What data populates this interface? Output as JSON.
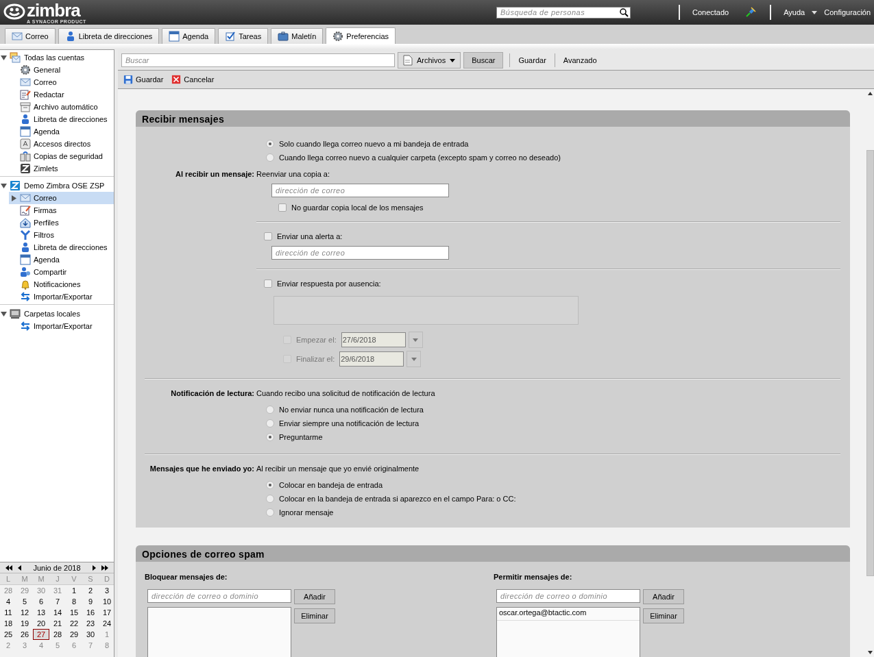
{
  "header": {
    "logo": "zimbra",
    "tagline": "A SYNACOR PRODUCT",
    "people_search": {
      "placeholder": "Búsqueda de personas"
    },
    "status": "Conectado",
    "help": "Ayuda",
    "settings": "Configuración"
  },
  "tabs": [
    {
      "label": "Correo",
      "kind": "mail",
      "selected": false
    },
    {
      "label": "Libreta de direcciones",
      "kind": "contact",
      "selected": false
    },
    {
      "label": "Agenda",
      "kind": "calendar",
      "selected": false
    },
    {
      "label": "Tareas",
      "kind": "tasks",
      "selected": false
    },
    {
      "label": "Maletín",
      "kind": "briefcase",
      "selected": false
    },
    {
      "label": "Preferencias",
      "kind": "gear",
      "selected": true
    }
  ],
  "sidebar": {
    "sections": [
      {
        "label": "Todas las cuentas",
        "kind": "accounts",
        "expanded": true,
        "items": [
          {
            "label": "General",
            "kind": "gear",
            "selected": false
          },
          {
            "label": "Correo",
            "kind": "mail",
            "selected": false
          },
          {
            "label": "Redactar",
            "kind": "compose",
            "selected": false
          },
          {
            "label": "Archivo automático",
            "kind": "archive",
            "selected": false
          },
          {
            "label": "Libreta de direcciones",
            "kind": "contact",
            "selected": false
          },
          {
            "label": "Agenda",
            "kind": "calendar",
            "selected": false
          },
          {
            "label": "Accesos directos",
            "kind": "key",
            "selected": false
          },
          {
            "label": "Copias de seguridad",
            "kind": "backup",
            "selected": false
          },
          {
            "label": "Zimlets",
            "kind": "zimlet",
            "selected": false
          }
        ]
      },
      {
        "label": "Demo Zimbra OSE ZSP",
        "kind": "account",
        "expanded": true,
        "items": [
          {
            "label": "Correo",
            "kind": "mail",
            "selected": true,
            "expanded": false
          },
          {
            "label": "Firmas",
            "kind": "signature",
            "selected": false
          },
          {
            "label": "Perfiles",
            "kind": "profile",
            "selected": false
          },
          {
            "label": "Filtros",
            "kind": "filter",
            "selected": false
          },
          {
            "label": "Libreta de direcciones",
            "kind": "contact",
            "selected": false
          },
          {
            "label": "Agenda",
            "kind": "calendar",
            "selected": false
          },
          {
            "label": "Compartir",
            "kind": "share",
            "selected": false
          },
          {
            "label": "Notificaciones",
            "kind": "bell",
            "selected": false
          },
          {
            "label": "Importar/Exportar",
            "kind": "transfer",
            "selected": false
          }
        ]
      },
      {
        "label": "Carpetas locales",
        "kind": "local",
        "expanded": true,
        "items": [
          {
            "label": "Importar/Exportar",
            "kind": "transfer",
            "selected": false
          }
        ]
      }
    ]
  },
  "calendar": {
    "title": "Junio de 2018",
    "weekdays": [
      "L",
      "M",
      "M",
      "J",
      "V",
      "S",
      "D"
    ],
    "weeks": [
      [
        {
          "day": "28",
          "outside": true,
          "selected": false
        },
        {
          "day": "29",
          "outside": true,
          "selected": false
        },
        {
          "day": "30",
          "outside": true,
          "selected": false
        },
        {
          "day": "31",
          "outside": true,
          "selected": false
        },
        {
          "day": "1",
          "outside": false,
          "selected": false
        },
        {
          "day": "2",
          "outside": false,
          "selected": false
        },
        {
          "day": "3",
          "outside": false,
          "selected": false
        }
      ],
      [
        {
          "day": "4",
          "outside": false,
          "selected": false
        },
        {
          "day": "5",
          "outside": false,
          "selected": false
        },
        {
          "day": "6",
          "outside": false,
          "selected": false
        },
        {
          "day": "7",
          "outside": false,
          "selected": false
        },
        {
          "day": "8",
          "outside": false,
          "selected": false
        },
        {
          "day": "9",
          "outside": false,
          "selected": false
        },
        {
          "day": "10",
          "outside": false,
          "selected": false
        }
      ],
      [
        {
          "day": "11",
          "outside": false,
          "selected": false
        },
        {
          "day": "12",
          "outside": false,
          "selected": false
        },
        {
          "day": "13",
          "outside": false,
          "selected": false
        },
        {
          "day": "14",
          "outside": false,
          "selected": false
        },
        {
          "day": "15",
          "outside": false,
          "selected": false
        },
        {
          "day": "16",
          "outside": false,
          "selected": false
        },
        {
          "day": "17",
          "outside": false,
          "selected": false
        }
      ],
      [
        {
          "day": "18",
          "outside": false,
          "selected": false
        },
        {
          "day": "19",
          "outside": false,
          "selected": false
        },
        {
          "day": "20",
          "outside": false,
          "selected": false
        },
        {
          "day": "21",
          "outside": false,
          "selected": false
        },
        {
          "day": "22",
          "outside": false,
          "selected": false
        },
        {
          "day": "23",
          "outside": false,
          "selected": false
        },
        {
          "day": "24",
          "outside": false,
          "selected": false
        }
      ],
      [
        {
          "day": "25",
          "outside": false,
          "selected": false
        },
        {
          "day": "26",
          "outside": false,
          "selected": false
        },
        {
          "day": "27",
          "outside": false,
          "selected": true
        },
        {
          "day": "28",
          "outside": false,
          "selected": false
        },
        {
          "day": "29",
          "outside": false,
          "selected": false
        },
        {
          "day": "30",
          "outside": false,
          "selected": false
        },
        {
          "day": "1",
          "outside": true,
          "selected": false
        }
      ],
      [
        {
          "day": "2",
          "outside": true,
          "selected": false
        },
        {
          "day": "3",
          "outside": true,
          "selected": false
        },
        {
          "day": "4",
          "outside": true,
          "selected": false
        },
        {
          "day": "5",
          "outside": true,
          "selected": false
        },
        {
          "day": "6",
          "outside": true,
          "selected": false
        },
        {
          "day": "7",
          "outside": true,
          "selected": false
        },
        {
          "day": "8",
          "outside": true,
          "selected": false
        }
      ]
    ]
  },
  "search": {
    "placeholder": "Buscar",
    "scope": "Archivos",
    "search_button": "Buscar",
    "save": "Guardar",
    "advanced": "Avanzado"
  },
  "actions": [
    {
      "label": "Guardar",
      "kind": "save"
    },
    {
      "label": "Cancelar",
      "kind": "cancel"
    }
  ],
  "receive": {
    "title": "Recibir mensajes",
    "notify_options": [
      {
        "label": "Solo cuando llega correo nuevo a mi bandeja de entrada",
        "selected": true
      },
      {
        "label": "Cuando llega correo nuevo a cualquier carpeta (excepto spam y correo no deseado)",
        "selected": false
      }
    ],
    "forward": {
      "label": "Al recibir un mensaje:",
      "text": "Reenviar una copia a:",
      "placeholder": "dirección de correo",
      "no_local_copy": {
        "label": "No guardar copia local de los mensajes",
        "checked": false
      }
    },
    "alert": {
      "label": "Enviar una alerta a:",
      "checked": false,
      "placeholder": "dirección de correo"
    },
    "away": {
      "label": "Enviar respuesta por ausencia:",
      "checked": false,
      "dates": [
        {
          "label": "Empezar el:",
          "value": "27/6/2018",
          "checked": false,
          "disabled": true
        },
        {
          "label": "Finalizar el:",
          "value": "29/6/2018",
          "checked": false,
          "disabled": true
        }
      ]
    },
    "read_receipt": {
      "label": "Notificación de lectura:",
      "text": "Cuando recibo una solicitud de notificación de lectura",
      "options": [
        {
          "label": "No enviar nunca una notificación de lectura",
          "selected": false
        },
        {
          "label": "Enviar siempre una notificación de lectura",
          "selected": false
        },
        {
          "label": "Preguntarme",
          "selected": true
        }
      ]
    },
    "sent": {
      "label": "Mensajes que he enviado yo:",
      "text": "Al recibir un mensaje que yo envié originalmente",
      "options": [
        {
          "label": "Colocar en bandeja de entrada",
          "selected": true
        },
        {
          "label": "Colocar en la bandeja de entrada si aparezco en el campo Para: o CC:",
          "selected": false
        },
        {
          "label": "Ignorar mensaje",
          "selected": false
        }
      ]
    }
  },
  "spam": {
    "title": "Opciones de correo spam",
    "lists": [
      {
        "label": "Bloquear mensajes de:",
        "placeholder": "dirección de correo o dominio",
        "add": "Añadir",
        "remove": "Eliminar"
      },
      {
        "label": "Permitir mensajes de:",
        "placeholder": "dirección de correo o dominio",
        "add": "Añadir",
        "remove": "Eliminar",
        "entries": [
          "oscar.ortega@btactic.com"
        ]
      }
    ]
  }
}
